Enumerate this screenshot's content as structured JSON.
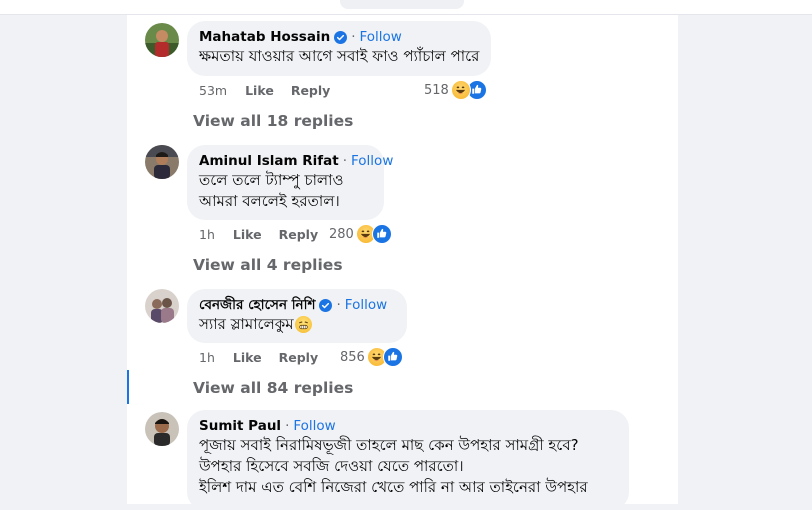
{
  "comments": [
    {
      "author": "Mahatab Hossain",
      "verified": true,
      "follow_label": "Follow",
      "text_lines": [
        "ক্ষমতায় যাওয়ার আগে সবাই ফাও প্যাঁচাল পারে"
      ],
      "time": "53m",
      "like_label": "Like",
      "reply_label": "Reply",
      "reaction_count": "518",
      "view_replies": "View all 18 replies"
    },
    {
      "author": "Aminul Islam Rifat",
      "verified": false,
      "follow_label": "Follow",
      "text_lines": [
        "তলে তলে ট্যাম্পু চালাও",
        "আমরা বললেই হরতাল।"
      ],
      "time": "1h",
      "like_label": "Like",
      "reply_label": "Reply",
      "reaction_count": "280",
      "view_replies": "View all 4 replies"
    },
    {
      "author": "বেনজীর হোসেন নিশি",
      "verified": true,
      "follow_label": "Follow",
      "text_lines": [
        "স্যার স্লামালেকুম"
      ],
      "time": "1h",
      "like_label": "Like",
      "reply_label": "Reply",
      "reaction_count": "856",
      "view_replies": "View all 84 replies"
    },
    {
      "author": "Sumit Paul",
      "verified": false,
      "follow_label": "Follow",
      "text_lines": [
        "পূজায় সবাই নিরামিষভূজী তাহলে মাছ কেন উপহার সামগ্রী হবে?",
        "উপহার হিসেবে সবজি দেওয়া যেতে পারতো।",
        "ইলিশ দাম এত বেশি নিজেরা খেতে পারি না আর তাইনেরা উপহার"
      ]
    }
  ],
  "separator": "·",
  "colors": {
    "page_bg": "#f0f2f5",
    "bubble_bg": "#f0f2f5",
    "link_blue": "#1b74e4",
    "meta_gray": "#65676b"
  },
  "icons": {
    "verified": "verified-badge-icon",
    "haha": "haha-reaction-icon",
    "like": "like-reaction-icon",
    "emoji_in_text": "grimace-emoji-icon"
  }
}
